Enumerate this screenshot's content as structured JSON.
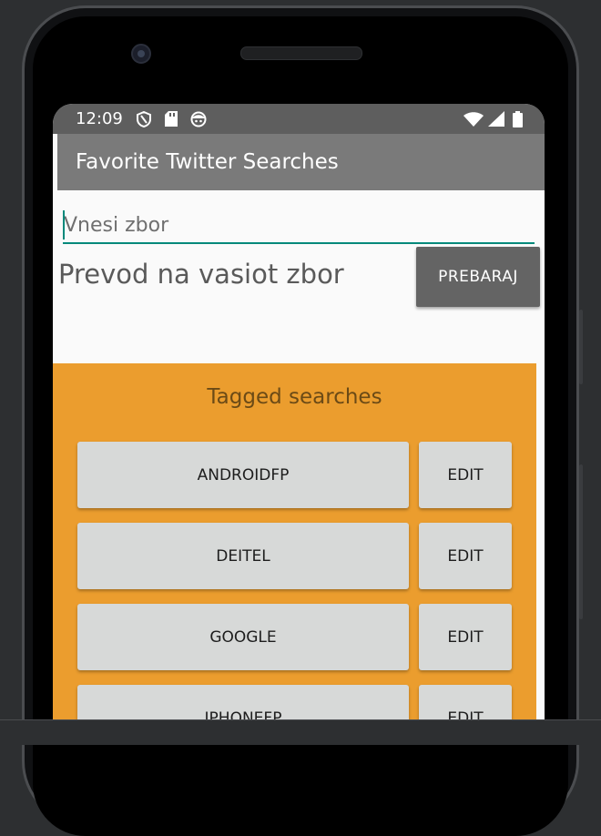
{
  "status_bar": {
    "time": "12:09",
    "left_icons": [
      "shield-icon",
      "sd-card-icon",
      "face-icon"
    ],
    "right_icons": [
      "wifi-icon",
      "signal-icon",
      "battery-icon"
    ]
  },
  "app_bar": {
    "title": "Favorite Twitter Searches"
  },
  "query": {
    "placeholder": "Vnesi zbor",
    "value": ""
  },
  "tag": {
    "label": "Prevod na vasiot zbor"
  },
  "search_button": {
    "label": "PREBARAJ"
  },
  "tagged": {
    "title": "Tagged searches",
    "items": [
      {
        "tag": "ANDROIDFP",
        "edit": "EDIT"
      },
      {
        "tag": "DEITEL",
        "edit": "EDIT"
      },
      {
        "tag": "GOOGLE",
        "edit": "EDIT"
      },
      {
        "tag": "IPHONEFP",
        "edit": "EDIT"
      }
    ]
  },
  "colors": {
    "accent": "#00897b",
    "app_bar": "#7a7a7a",
    "tagged_background": "#eb9d2e",
    "button": "#d7d9d8",
    "search_button": "#646464"
  }
}
